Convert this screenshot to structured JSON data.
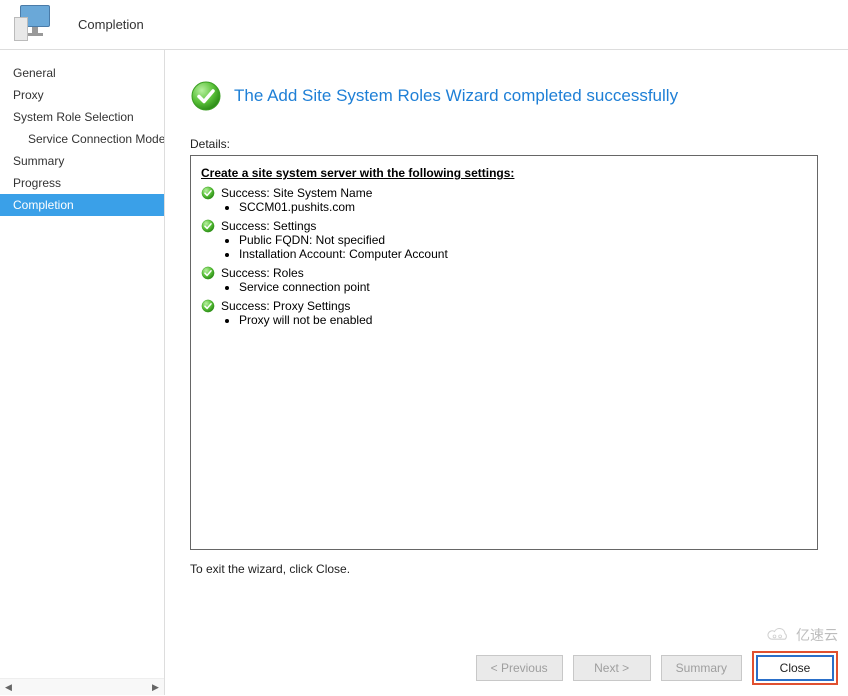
{
  "header": {
    "title": "Completion"
  },
  "sidebar": {
    "items": [
      {
        "label": "General"
      },
      {
        "label": "Proxy"
      },
      {
        "label": "System Role Selection"
      },
      {
        "label": "Service Connection Mode",
        "indent": true
      },
      {
        "label": "Summary"
      },
      {
        "label": "Progress"
      },
      {
        "label": "Completion",
        "selected": true
      }
    ]
  },
  "content": {
    "banner_title": "The Add Site System Roles Wizard completed successfully",
    "details_label": "Details:",
    "details_heading": "Create a site system server with the following settings:",
    "successes": [
      {
        "title": "Success: Site System Name",
        "items": [
          "SCCM01.pushits.com"
        ]
      },
      {
        "title": "Success: Settings",
        "items": [
          "Public FQDN: Not specified",
          "Installation Account: Computer Account"
        ]
      },
      {
        "title": "Success: Roles",
        "items": [
          "Service connection point"
        ]
      },
      {
        "title": "Success: Proxy Settings",
        "items": [
          "Proxy will not be enabled"
        ]
      }
    ],
    "exit_text": "To exit the wizard, click Close."
  },
  "buttons": {
    "previous": "< Previous",
    "next": "Next >",
    "summary": "Summary",
    "close": "Close"
  },
  "watermark": "亿速云"
}
